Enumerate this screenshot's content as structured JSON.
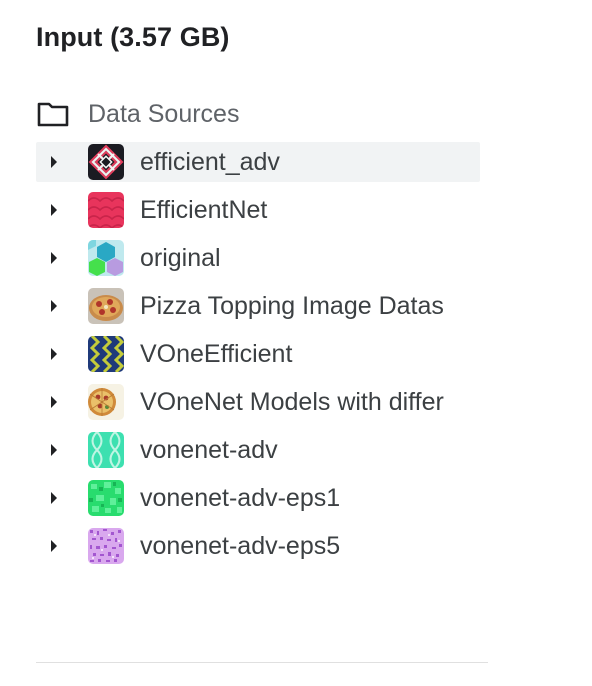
{
  "panel": {
    "title": "Input (3.57 GB)"
  },
  "section": {
    "label": "Data Sources",
    "icon": "folder-icon"
  },
  "items": [
    {
      "label": "efficient_adv",
      "icon": "efficient-adv-thumbnail",
      "selected": true
    },
    {
      "label": "EfficientNet",
      "icon": "efficientnet-thumbnail",
      "selected": false
    },
    {
      "label": "original",
      "icon": "original-thumbnail",
      "selected": false
    },
    {
      "label": "Pizza Topping Image Datas",
      "icon": "pizza-thumbnail",
      "selected": false
    },
    {
      "label": "VOneEfficient",
      "icon": "voneefficient-thumbnail",
      "selected": false
    },
    {
      "label": "VOneNet Models with differ",
      "icon": "vonenet-models-thumbnail",
      "selected": false
    },
    {
      "label": "vonenet-adv",
      "icon": "vonenet-adv-thumbnail",
      "selected": false
    },
    {
      "label": "vonenet-adv-eps1",
      "icon": "vonenet-adv-eps1-thumbnail",
      "selected": false
    },
    {
      "label": "vonenet-adv-eps5",
      "icon": "vonenet-adv-eps5-thumbnail",
      "selected": false
    }
  ],
  "colors": {
    "selected_row_bg": "#f1f3f4",
    "title_text": "#202124",
    "item_text": "#3c4043",
    "section_text": "#5f6368"
  }
}
